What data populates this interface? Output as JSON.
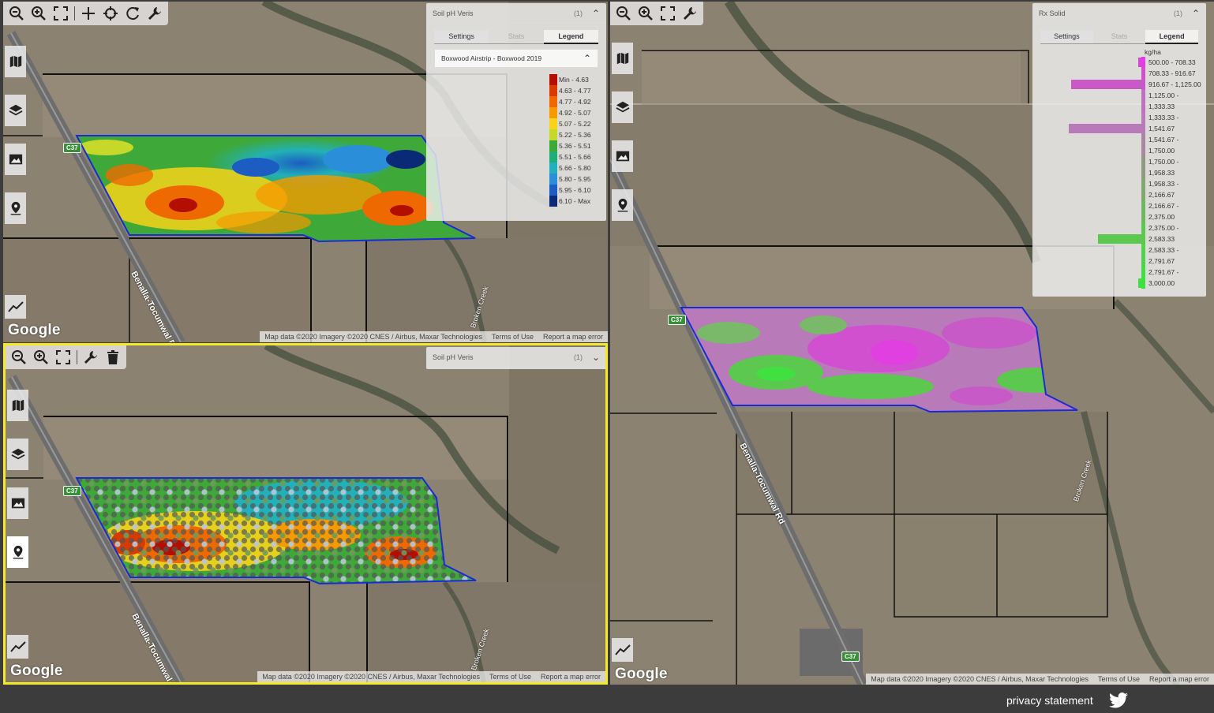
{
  "maps": {
    "top_left": {
      "layer_title": "Soil pH Veris",
      "layer_count": "(1)",
      "tabs": [
        "Settings",
        "Stats",
        "Legend"
      ],
      "layer_row": "Boxwood Airstrip - Boxwood 2019",
      "legend": [
        {
          "label": "Min - 4.63",
          "color": "#b30f00"
        },
        {
          "label": "4.63 - 4.77",
          "color": "#d93a00"
        },
        {
          "label": "4.77 - 4.92",
          "color": "#ee6a00"
        },
        {
          "label": "4.92 - 5.07",
          "color": "#f59a00"
        },
        {
          "label": "5.07 - 5.22",
          "color": "#f7d41a"
        },
        {
          "label": "5.22 - 5.36",
          "color": "#c6d92b"
        },
        {
          "label": "5.36 - 5.51",
          "color": "#3ea838"
        },
        {
          "label": "5.51 - 5.66",
          "color": "#1fae7a"
        },
        {
          "label": "5.66 - 5.80",
          "color": "#22b1b8"
        },
        {
          "label": "5.80 - 5.95",
          "color": "#2a8ed8"
        },
        {
          "label": "5.95 - 6.10",
          "color": "#1d5cc2"
        },
        {
          "label": "6.10 - Max",
          "color": "#0a2a78"
        }
      ],
      "google": "Google",
      "attribution": [
        "Map data ©2020 Imagery ©2020 CNES / Airbus, Maxar Technologies",
        "Terms of Use",
        "Report a map error"
      ],
      "road": "Benalla-Tocumwal Rd",
      "shield": "C37",
      "creek": "Broken Creek"
    },
    "bottom_left": {
      "layer_title": "Soil pH Veris",
      "layer_count": "(1)",
      "google": "Google",
      "attribution": [
        "Map data ©2020 Imagery ©2020 CNES / Airbus, Maxar Technologies",
        "Terms of Use",
        "Report a map error"
      ],
      "road": "Benalla-Tocumwal Rd",
      "shield": "C37",
      "creek": "Broken Creek"
    },
    "right": {
      "layer_title": "Rx Solid",
      "layer_count": "(1)",
      "tabs": [
        "Settings",
        "Stats",
        "Legend"
      ],
      "legend_unit": "kg/ha",
      "histogram": [
        {
          "label": "500.00 - 708.33",
          "value": 0.04,
          "color": "#e040e0"
        },
        {
          "label": "708.33 - 916.67",
          "value": 0.0,
          "color": "#d04fd0"
        },
        {
          "label": "916.67 - 1,125.00",
          "value": 0.97,
          "color": "#c85ac8"
        },
        {
          "label": "1,125.00 -",
          "value": 0.0,
          "color": "#c070c0"
        },
        {
          "label": "1,333.33",
          "value": 0.0,
          "color": "#c070c0"
        },
        {
          "label": "1,333.33 -",
          "value": 0.0,
          "color": "#b87ab8"
        },
        {
          "label": "1,541.67",
          "value": 1.0,
          "color": "#b87ab8"
        },
        {
          "label": "1,541.67 -",
          "value": 0.0,
          "color": "#a888a0"
        },
        {
          "label": "1,750.00",
          "value": 0.0,
          "color": "#a888a0"
        },
        {
          "label": "1,750.00 -",
          "value": 0.0,
          "color": "#909a80"
        },
        {
          "label": "1,958.33",
          "value": 0.0,
          "color": "#909a80"
        },
        {
          "label": "1,958.33 -",
          "value": 0.0,
          "color": "#80a870"
        },
        {
          "label": "2,166.67",
          "value": 0.0,
          "color": "#80a870"
        },
        {
          "label": "2,166.67 -",
          "value": 0.0,
          "color": "#70b860"
        },
        {
          "label": "2,375.00",
          "value": 0.0,
          "color": "#70b860"
        },
        {
          "label": "2,375.00 -",
          "value": 0.0,
          "color": "#5cc850"
        },
        {
          "label": "2,583.33",
          "value": 0.6,
          "color": "#5cc850"
        },
        {
          "label": "2,583.33 -",
          "value": 0.0,
          "color": "#4ed448"
        },
        {
          "label": "2,791.67",
          "value": 0.0,
          "color": "#4ed448"
        },
        {
          "label": "2,791.67 -",
          "value": 0.0,
          "color": "#40e040"
        },
        {
          "label": "3,000.00",
          "value": 0.04,
          "color": "#40e040"
        }
      ],
      "google": "Google",
      "attribution": [
        "Map data ©2020 Imagery ©2020 CNES / Airbus, Maxar Technologies",
        "Terms of Use",
        "Report a map error"
      ],
      "road": "Benalla-Tocumwal Rd",
      "shield_top": "C37",
      "shield_bottom": "C37",
      "creek": "Broken Creek"
    }
  },
  "footer": {
    "privacy": "privacy statement"
  },
  "icons": {
    "zoom_out": "zoom-out-icon",
    "zoom_in": "zoom-in-icon",
    "fullscreen": "fullscreen-icon",
    "plus": "plus-icon",
    "target": "target-icon",
    "refresh": "refresh-icon",
    "wrench": "wrench-icon",
    "trash": "trash-icon",
    "map": "map-icon",
    "layers": "layers-icon",
    "image": "image-icon",
    "pin": "pin-icon",
    "chart": "chart-icon",
    "twitter": "twitter-icon"
  }
}
